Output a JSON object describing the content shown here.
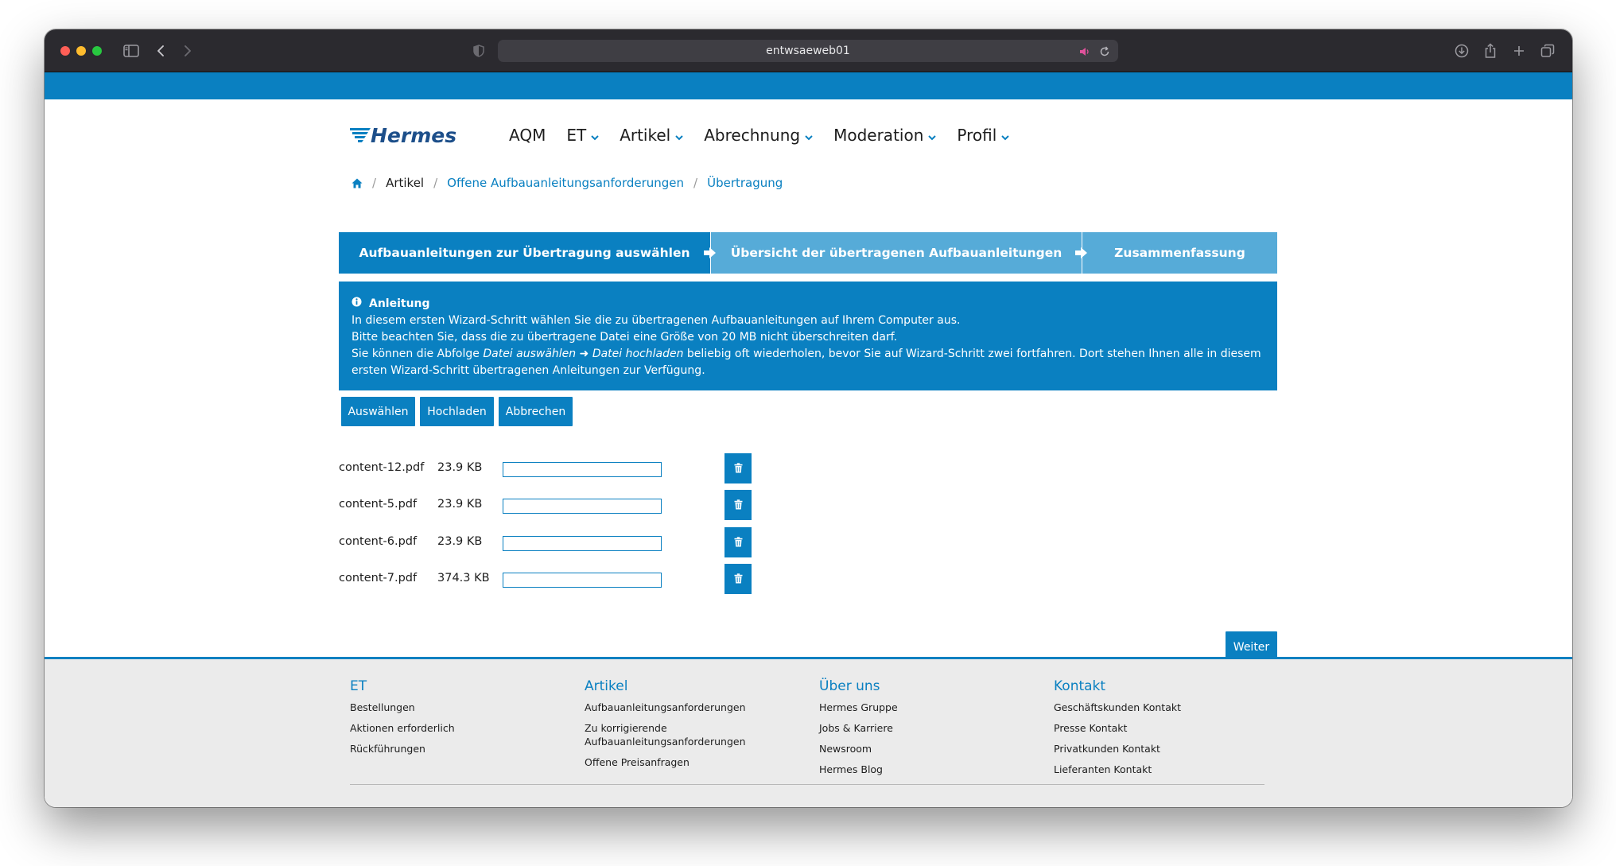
{
  "browser": {
    "url": "entwsaeweb01"
  },
  "nav": {
    "items": [
      {
        "label": "AQM",
        "has_dropdown": false
      },
      {
        "label": "ET",
        "has_dropdown": true
      },
      {
        "label": "Artikel",
        "has_dropdown": true
      },
      {
        "label": "Abrechnung",
        "has_dropdown": true
      },
      {
        "label": "Moderation",
        "has_dropdown": true
      },
      {
        "label": "Profil",
        "has_dropdown": true
      }
    ]
  },
  "breadcrumb": {
    "home_icon": "home-icon",
    "items": [
      "Artikel",
      "Offene Aufbauanleitungsanforderungen",
      "Übertragung"
    ]
  },
  "wizard": {
    "steps": [
      "Aufbauanleitungen zur Übertragung auswählen",
      "Übersicht der übertragenen Aufbauanleitungen",
      "Zusammenfassung"
    ],
    "active_step": 1
  },
  "info": {
    "title": "Anleitung",
    "line1": "In diesem ersten Wizard-Schritt wählen Sie die zu übertragenen Aufbauanleitungen auf Ihrem Computer aus.",
    "line2": "Bitte beachten Sie, dass die zu übertragene Datei eine Größe von 20 MB nicht überschreiten darf.",
    "line3_pre": "Sie können die Abfolge ",
    "line3_em1": "Datei auswählen",
    "line3_arrow": " ➜ ",
    "line3_em2": "Datei hochladen",
    "line3_post": " beliebig oft wiederholen, bevor Sie auf Wizard-Schritt zwei fortfahren. Dort stehen Ihnen alle in diesem",
    "line4": "ersten Wizard-Schritt übertragenen Anleitungen zur Verfügung."
  },
  "actions": {
    "select": "Auswählen",
    "upload": "Hochladen",
    "cancel": "Abbrechen"
  },
  "files": [
    {
      "name": "content-12.pdf",
      "size": "23.9 KB",
      "progress": 0
    },
    {
      "name": "content-5.pdf",
      "size": "23.9 KB",
      "progress": 0
    },
    {
      "name": "content-6.pdf",
      "size": "23.9 KB",
      "progress": 0
    },
    {
      "name": "content-7.pdf",
      "size": "374.3 KB",
      "progress": 0
    }
  ],
  "next_button": "Weiter",
  "footer": {
    "columns": [
      {
        "heading": "ET",
        "links": [
          "Bestellungen",
          "Aktionen erforderlich",
          "Rückführungen"
        ]
      },
      {
        "heading": "Artikel",
        "links": [
          "Aufbauanleitungsanforderungen",
          "Zu korrigierende Aufbauanleitungsanforderungen",
          "Offene Preisanfragen"
        ]
      },
      {
        "heading": "Über uns",
        "links": [
          "Hermes Gruppe",
          "Jobs & Karriere",
          "Newsroom",
          "Hermes Blog"
        ]
      },
      {
        "heading": "Kontakt",
        "links": [
          "Geschäftskunden Kontakt",
          "Presse Kontakt",
          "Privatkunden Kontakt",
          "Lieferanten Kontakt"
        ]
      }
    ]
  },
  "colors": {
    "brand_blue": "#0a80c1",
    "step_inactive": "#56abd8",
    "footer_bg": "#ebebeb",
    "titlebar": "#2b2a2f"
  }
}
